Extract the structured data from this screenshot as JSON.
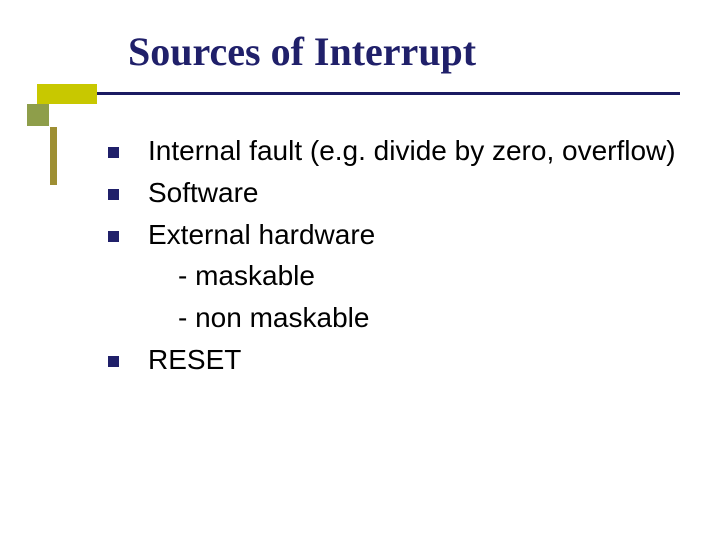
{
  "title": "Sources of Interrupt",
  "items": {
    "b1": "Internal fault (e.g. divide by zero, overflow)",
    "b2": "Software",
    "b3": "External hardware",
    "b3_sub1": "- maskable",
    "b3_sub2": "- non maskable",
    "b4": "RESET"
  }
}
